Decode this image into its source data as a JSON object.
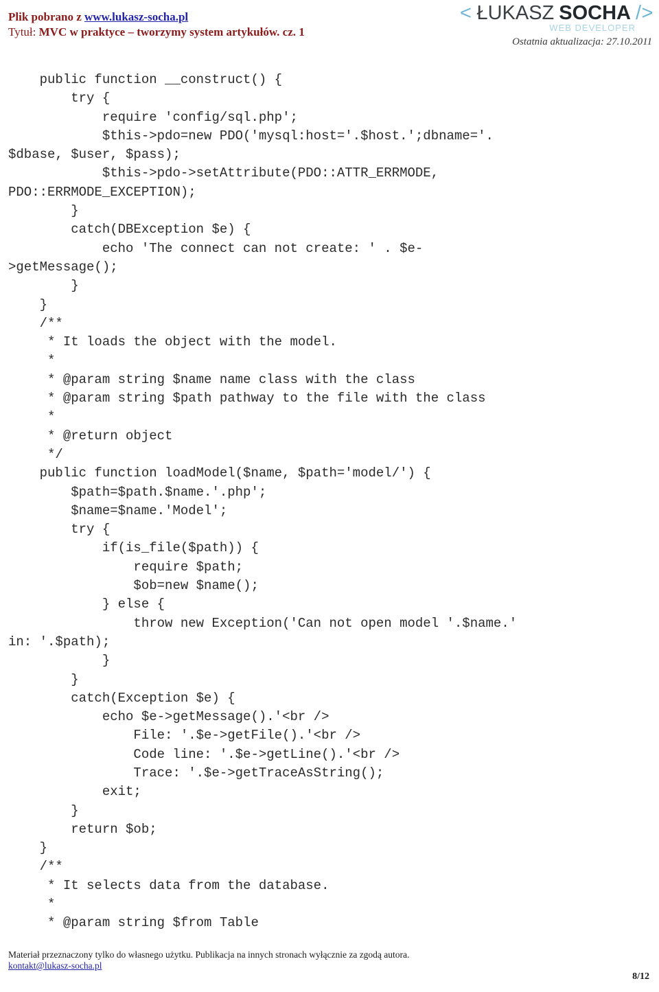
{
  "header": {
    "download_prefix": "Plik pobrano z ",
    "site_link": "www.lukasz-socha.pl",
    "title_label": "Tytuł: ",
    "title_value": "MVC w praktyce – tworzymy system artykułów. cz. 1",
    "logo": {
      "bracket_open": "<",
      "name_thin": "ŁUKASZ",
      "name_bold": "SOCHA",
      "bracket_close": "/>",
      "tagline": "WEB DEVELOPER"
    },
    "last_update": "Ostatnia aktualizacja: 27.10.2011"
  },
  "code": {
    "language": "php",
    "lines": [
      "    public function __construct() {",
      "        try {",
      "            require 'config/sql.php';",
      "            $this->pdo=new PDO('mysql:host='.$host.';dbname='.",
      "$dbase, $user, $pass);",
      "            $this->pdo->setAttribute(PDO::ATTR_ERRMODE,",
      "PDO::ERRMODE_EXCEPTION);",
      "        }",
      "        catch(DBException $e) {",
      "            echo 'The connect can not create: ' . $e-",
      ">getMessage();",
      "        }",
      "    }",
      "    /**",
      "     * It loads the object with the model.",
      "     *",
      "     * @param string $name name class with the class",
      "     * @param string $path pathway to the file with the class",
      "     *",
      "     * @return object",
      "     */",
      "    public function loadModel($name, $path='model/') {",
      "        $path=$path.$name.'.php';",
      "        $name=$name.'Model';",
      "        try {",
      "            if(is_file($path)) {",
      "                require $path;",
      "                $ob=new $name();",
      "            } else {",
      "                throw new Exception('Can not open model '.$name.'",
      "in: '.$path);",
      "            }",
      "        }",
      "        catch(Exception $e) {",
      "            echo $e->getMessage().'<br />",
      "                File: '.$e->getFile().'<br />",
      "                Code line: '.$e->getLine().'<br />",
      "                Trace: '.$e->getTraceAsString();",
      "            exit;",
      "        }",
      "        return $ob;",
      "    }",
      "    /**",
      "     * It selects data from the database.",
      "     *",
      "     * @param string $from Table"
    ]
  },
  "footer": {
    "note": "Materiał przeznaczony tylko do własnego użytku. Publikacja na innych stronach wyłącznie za zgodą autora.",
    "email": "kontakt@lukasz-socha.pl",
    "page_number": "8/12"
  },
  "colors": {
    "header_text": "#8B1A1A",
    "link": "#2222AA",
    "code_text": "#2b2b2b",
    "logo_accent": "#6FB6D6",
    "logo_tagline": "#A8D3E4",
    "page_background": "#ffffff"
  }
}
